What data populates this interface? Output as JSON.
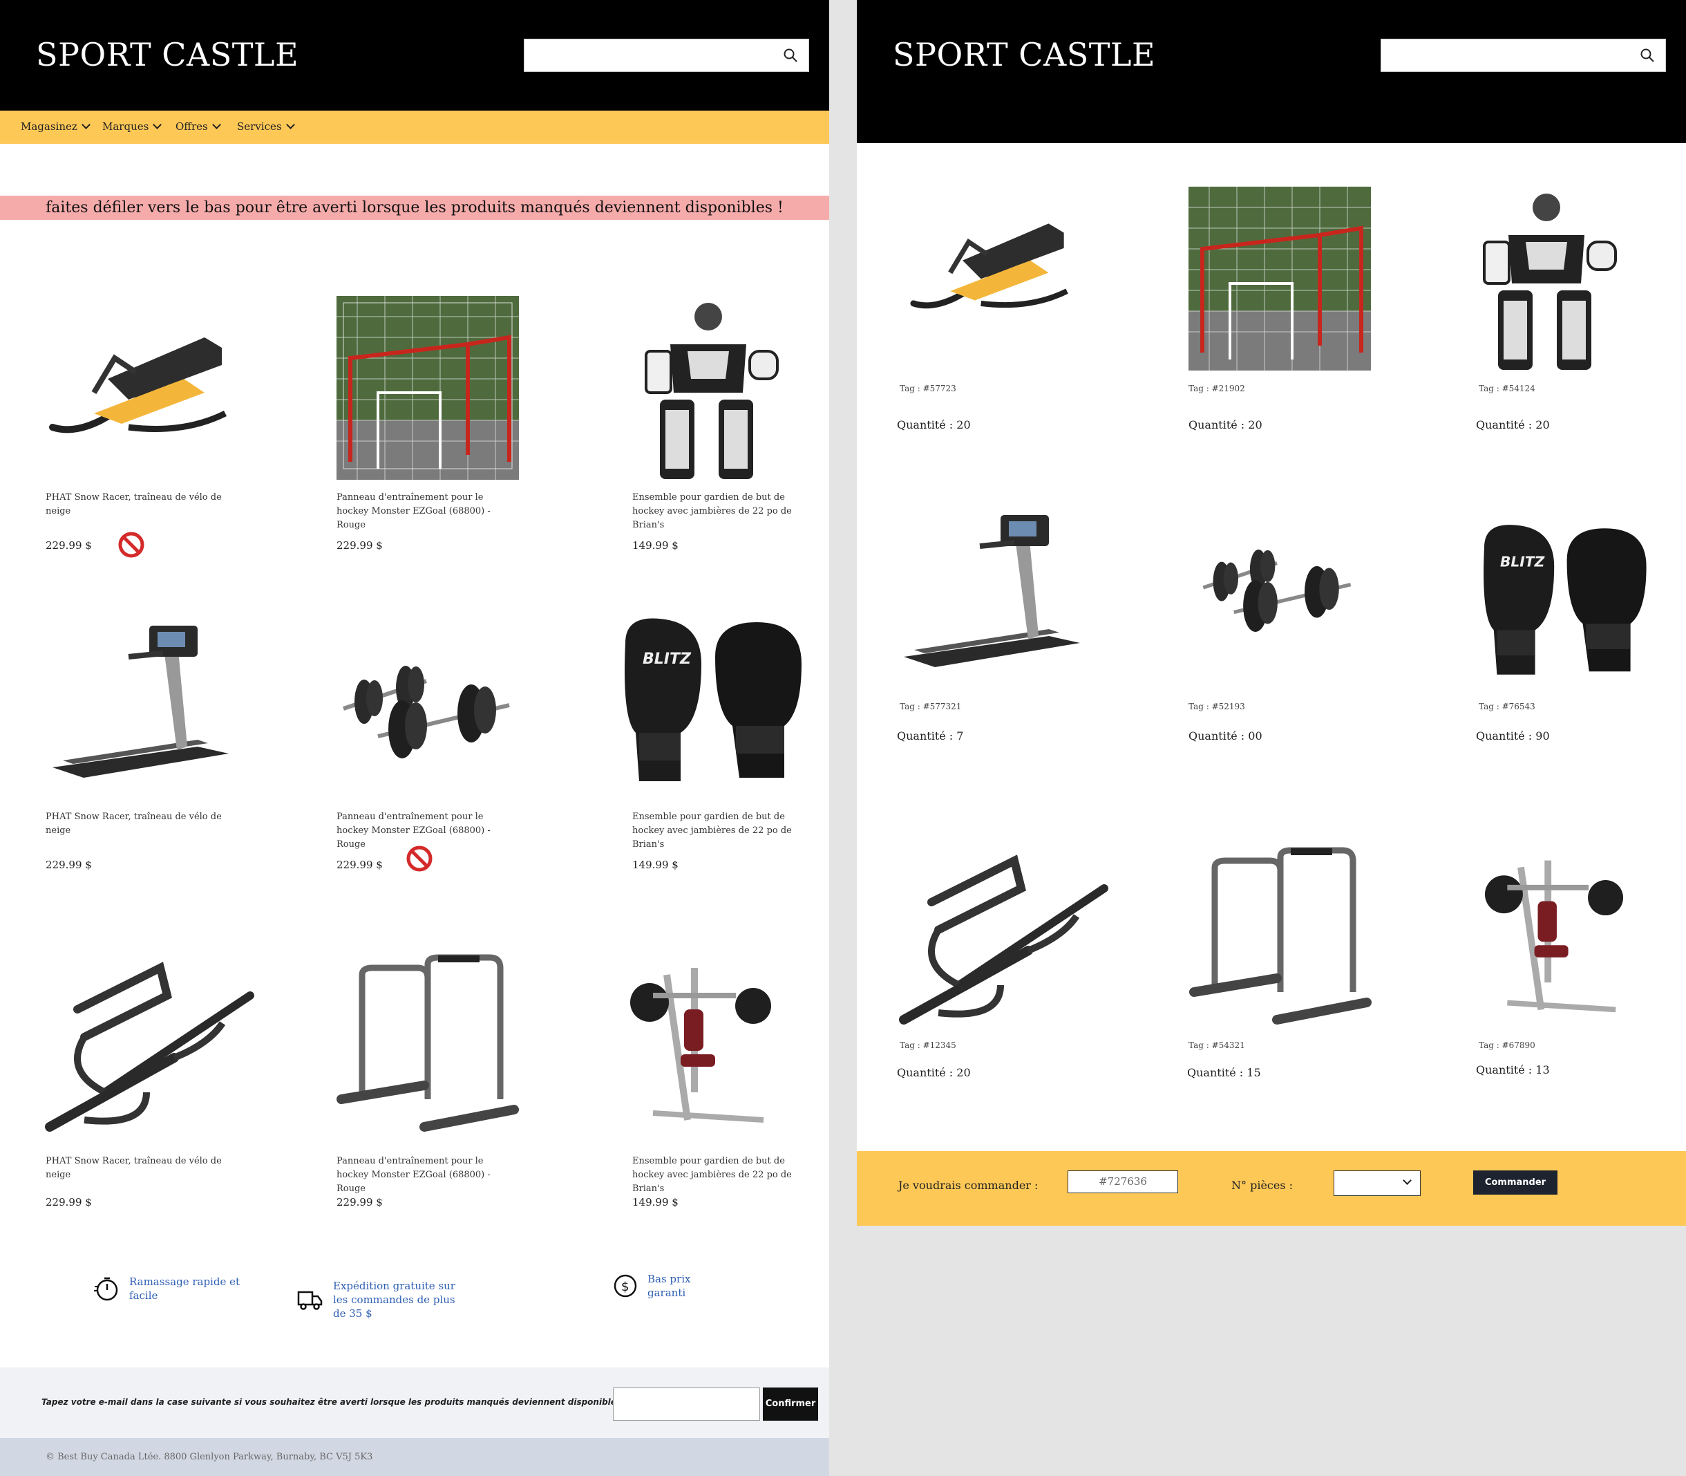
{
  "brand": "SPORT CASTLE",
  "nav": [
    "Magasinez",
    "Marques",
    "Offres",
    "Services"
  ],
  "banner": "faites défiler vers le bas pour être averti lorsque les produits manqués deviennent disponibles !",
  "products": [
    {
      "title": "PHAT Snow Racer, traîneau de vélo de neige",
      "price": "229.99 $",
      "unavailable": true,
      "image": "snow-racer-sled"
    },
    {
      "title": "Panneau d'entraînement pour le hockey Monster EZGoal (68800) - Rouge",
      "price": "229.99 $",
      "unavailable": false,
      "image": "hockey-goal-net"
    },
    {
      "title": "Ensemble pour gardien de but de hockey avec jambières de 22 po de Brian's",
      "price": "149.99 $",
      "unavailable": false,
      "image": "goalie-gear-set"
    },
    {
      "title": "PHAT Snow Racer, traîneau de vélo de neige",
      "price": "229.99 $",
      "unavailable": false,
      "image": "treadmill"
    },
    {
      "title": "Panneau d'entraînement pour le hockey Monster EZGoal (68800) - Rouge",
      "price": "229.99 $",
      "unavailable": true,
      "image": "dumbbells"
    },
    {
      "title": "Ensemble pour gardien de but de hockey avec jambières de 22 po de Brian's",
      "price": "149.99 $",
      "unavailable": false,
      "image": "boxing-gloves"
    },
    {
      "title": "PHAT Snow Racer, traîneau de vélo de neige",
      "price": "229.99 $",
      "unavailable": false,
      "image": "pull-up-bar"
    },
    {
      "title": "Panneau d'entraînement pour le hockey Monster EZGoal (68800) - Rouge",
      "price": "229.99 $",
      "unavailable": false,
      "image": "dip-station"
    },
    {
      "title": "Ensemble pour gardien de but de hockey avec jambières de 22 po de Brian's",
      "price": "149.99 $",
      "unavailable": false,
      "image": "chest-press-machine"
    }
  ],
  "features": [
    {
      "icon": "stopwatch-icon",
      "text": "Ramassage rapide et facile"
    },
    {
      "icon": "truck-icon",
      "text": "Expédition gratuite sur les commandes de plus de 35 $"
    },
    {
      "icon": "dollar-icon",
      "text": "Bas prix garanti"
    }
  ],
  "email": {
    "label": "Tapez votre e-mail dans la case suivante si vous souhaitez être averti lorsque les produits manqués deviennent disponibles :",
    "button": "Confirmer",
    "value": ""
  },
  "footer": "© Best Buy Canada Ltée. 8800 Glenlyon Parkway, Burnaby, BC V5J 5K3",
  "inventory": [
    {
      "tag": "Tag : #57723",
      "qty": "Quantité : 20"
    },
    {
      "tag": "Tag : #21902",
      "qty": "Quantité : 20"
    },
    {
      "tag": "Tag : #54124",
      "qty": "Quantité : 20"
    },
    {
      "tag": "Tag : #577321",
      "qty": "Quantité : 7"
    },
    {
      "tag": "Tag : #52193",
      "qty": "Quantité : 00"
    },
    {
      "tag": "Tag : #76543",
      "qty": "Quantité : 90"
    },
    {
      "tag": "Tag : #12345",
      "qty": "Quantité : 20"
    },
    {
      "tag": "Tag : #54321",
      "qty": "Quantité : 15"
    },
    {
      "tag": "Tag : #67890",
      "qty": "Quantité : 13"
    }
  ],
  "order": {
    "label": "Je voudrais commander :",
    "tag_value": "#727636",
    "pieces_label": "N° pièces :",
    "pieces_value": "",
    "button": "Commander"
  },
  "colors": {
    "header": "#000000",
    "accent": "#fec857",
    "banner": "#f6abab",
    "link": "#2f5fb4"
  }
}
